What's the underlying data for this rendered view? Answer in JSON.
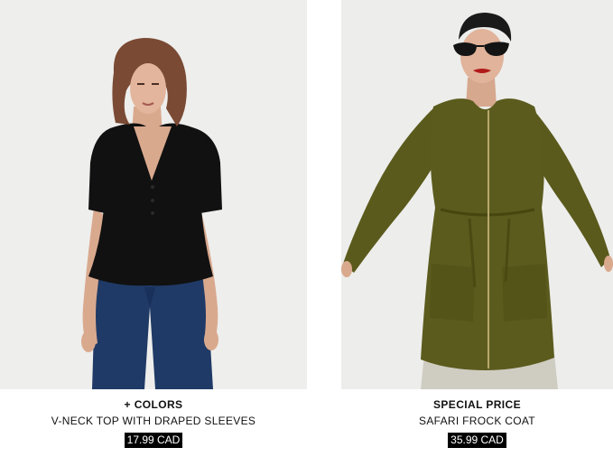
{
  "products": [
    {
      "badge": "+ COLORS",
      "name": "V-NECK TOP WITH DRAPED SLEEVES",
      "price": "17.99 CAD",
      "image_alt": "Model wearing black v-neck top with draped sleeves and blue jeans"
    },
    {
      "badge": "SPECIAL PRICE",
      "name": "SAFARI FROCK COAT",
      "price": "35.99 CAD",
      "image_alt": "Model wearing olive green safari frock coat with zip front and sunglasses"
    }
  ],
  "colors": {
    "background": "#ffffff",
    "photo_bg": "#eeeeec",
    "price_tag_bg": "#000000",
    "price_tag_text": "#ffffff",
    "text": "#111111"
  }
}
